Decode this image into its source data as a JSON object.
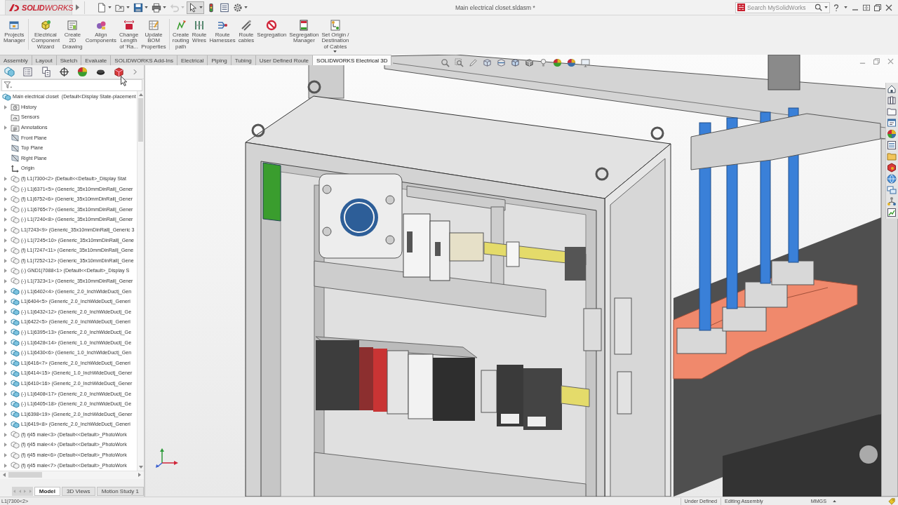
{
  "title_bar": {
    "logo": "**SOLID**WORKS",
    "title": "Main electrical closet.sldasm *",
    "search": {
      "placeholder": "Search MySolidWorks"
    }
  },
  "quick_access": [
    {
      "kind": "new",
      "dropdown": true,
      "disabled": false,
      "pressed": false
    },
    {
      "kind": "open",
      "dropdown": true,
      "disabled": false,
      "pressed": false
    },
    {
      "kind": "save",
      "dropdown": true,
      "disabled": false,
      "pressed": false
    },
    {
      "kind": "print",
      "dropdown": true,
      "disabled": false,
      "pressed": false
    },
    {
      "kind": "undo",
      "dropdown": true,
      "disabled": true,
      "pressed": false
    },
    {
      "kind": "select",
      "dropdown": true,
      "disabled": false,
      "pressed": true
    },
    {
      "kind": "rebuild",
      "dropdown": false,
      "disabled": false,
      "pressed": false
    },
    {
      "kind": "properties",
      "dropdown": false,
      "disabled": false,
      "pressed": false
    },
    {
      "kind": "options",
      "dropdown": true,
      "disabled": false,
      "pressed": false
    }
  ],
  "ribbon": [
    {
      "buttons": [
        {
          "label": "Projects\nManager",
          "dropdown": false
        }
      ]
    },
    {
      "buttons": [
        {
          "label": "Electrical\nComponent\nWizard",
          "dropdown": false
        },
        {
          "label": "Create\n2D\nDrawing",
          "dropdown": false
        },
        {
          "label": "Align\nComponents",
          "dropdown": false
        },
        {
          "label": "Change\nLength\nof 'Ra...",
          "dropdown": false
        },
        {
          "label": "Update\nBOM\nProperties",
          "dropdown": false
        }
      ]
    },
    {
      "buttons": [
        {
          "label": "Create\nrouting\npath",
          "dropdown": false
        },
        {
          "label": "Route\nWires",
          "dropdown": false
        },
        {
          "label": "Route\nHarnesses",
          "dropdown": false
        },
        {
          "label": "Route\ncables",
          "dropdown": false
        },
        {
          "label": "Segregation",
          "dropdown": false
        },
        {
          "label": "Segregation\nManager",
          "dropdown": false
        },
        {
          "label": "Set Origin /\nDestination\nof Cables",
          "dropdown": true
        }
      ]
    }
  ],
  "tabs": [
    {
      "label": "Assembly",
      "selected": false
    },
    {
      "label": "Layout",
      "selected": false
    },
    {
      "label": "Sketch",
      "selected": false
    },
    {
      "label": "Evaluate",
      "selected": false
    },
    {
      "label": "SOLIDWORKS Add-Ins",
      "selected": false
    },
    {
      "label": "Electrical",
      "selected": false
    },
    {
      "label": "Piping",
      "selected": false
    },
    {
      "label": "Tubing",
      "selected": false
    },
    {
      "label": "User Defined Route",
      "selected": false
    },
    {
      "label": "SOLIDWORKS Electrical 3D",
      "selected": true
    }
  ],
  "feature_manager": {
    "tree": {
      "label": "Main electrical closet  (Default<Display State-placement",
      "kind": "assembly",
      "children": [
        {
          "label": "History",
          "kind": "history",
          "expandable": true
        },
        {
          "label": "Sensors",
          "kind": "sensors",
          "expandable": false
        },
        {
          "label": "Annotations",
          "kind": "annotations",
          "expandable": true
        },
        {
          "label": "Front Plane",
          "kind": "plane",
          "expandable": false
        },
        {
          "label": "Top Plane",
          "kind": "plane",
          "expandable": false
        },
        {
          "label": "Right Plane",
          "kind": "plane",
          "expandable": false
        },
        {
          "label": "Origin",
          "kind": "origin",
          "expandable": false
        },
        {
          "label": "(f) L1|7300<2> (Default<<Default>_Display Stat",
          "kind": "component",
          "expandable": true
        },
        {
          "label": "(-) L1|6371<5> (Generic_35x10mmDinRail|_Gener",
          "kind": "component",
          "expandable": true
        },
        {
          "label": "(f) L1|6752<6> (Generic_35x10mmDinRail|_Gener",
          "kind": "component",
          "expandable": true
        },
        {
          "label": "(-) L1|6765<7> (Generic_35x10mmDinRail|_Gener",
          "kind": "component",
          "expandable": true
        },
        {
          "label": "(-) L1|7240<8> (Generic_35x10mmDinRail|_Gener",
          "kind": "component",
          "expandable": true
        },
        {
          "label": "L1|7243<9> (Generic_35x10mmDinRail|_Generic 3",
          "kind": "component",
          "expandable": true
        },
        {
          "label": "(-) L1|7245<10> (Generic_35x10mmDinRail|_Gene",
          "kind": "component",
          "expandable": true
        },
        {
          "label": "(f) L1|7247<11> (Generic_35x10mmDinRail|_Gene",
          "kind": "component",
          "expandable": true
        },
        {
          "label": "(f) L1|7252<12> (Generic_35x10mmDinRail|_Gene",
          "kind": "component",
          "expandable": true
        },
        {
          "label": "(-) GND1|7088<1> (Default<<Default>_Display S",
          "kind": "component",
          "expandable": true
        },
        {
          "label": "(-) L1|7323<1> (Generic_35x10mmDinRail|_Gener",
          "kind": "component",
          "expandable": true
        },
        {
          "label": "(-) L1|6402<4> (Generic_2.0_InchWideDuct|_Gen",
          "kind": "assembly",
          "expandable": true
        },
        {
          "label": "L1|6404<5> (Generic_2.0_InchWideDuct|_Generi",
          "kind": "assembly",
          "expandable": true
        },
        {
          "label": "(-) L1|6432<12> (Generic_2.0_InchWideDuct|_Ge",
          "kind": "assembly",
          "expandable": true
        },
        {
          "label": "L1|6422<5> (Generic_2.0_InchWideDuct|_Generi",
          "kind": "assembly",
          "expandable": true
        },
        {
          "label": "(-) L1|6395<13> (Generic_2.0_InchWideDuct|_Ge",
          "kind": "assembly",
          "expandable": true
        },
        {
          "label": "(-) L1|6428<14> (Generic_1.0_InchWideDuct|_Ge",
          "kind": "assembly",
          "expandable": true
        },
        {
          "label": "(-) L1|6430<6> (Generic_1.0_InchWideDuct|_Gen",
          "kind": "assembly",
          "expandable": true
        },
        {
          "label": "L1|6416<7> (Generic_2.0_InchWideDuct|_Generi",
          "kind": "assembly",
          "expandable": true
        },
        {
          "label": "L1|6414<15> (Generic_1.0_InchWideDuct|_Gener",
          "kind": "assembly",
          "expandable": true
        },
        {
          "label": "L1|6410<16> (Generic_2.0_InchWideDuct|_Gener",
          "kind": "assembly",
          "expandable": true
        },
        {
          "label": "(-) L1|6408<17> (Generic_2.0_InchWideDuct|_Ge",
          "kind": "assembly",
          "expandable": true
        },
        {
          "label": "(-) L1|6405<18> (Generic_2.0_InchWideDuct|_Ge",
          "kind": "assembly",
          "expandable": true
        },
        {
          "label": "L1|6398<19> (Generic_2.0_InchWideDuct|_Gener",
          "kind": "assembly",
          "expandable": true
        },
        {
          "label": "L1|6419<8> (Generic_2.0_InchWideDuct|_Generi",
          "kind": "assembly",
          "expandable": true
        },
        {
          "label": "(f) rj45 male<3> (Default<<Default>_PhotoWork",
          "kind": "component",
          "expandable": true
        },
        {
          "label": "(f) rj45 male<4> (Default<<Default>_PhotoWork",
          "kind": "component",
          "expandable": true
        },
        {
          "label": "(f) rj45 male<6> (Default<<Default>_PhotoWork",
          "kind": "component",
          "expandable": true
        },
        {
          "label": "(f) rj45 male<7> (Default<<Default>_PhotoWork",
          "kind": "component",
          "expandable": true
        }
      ]
    }
  },
  "model_tabs": [
    {
      "label": "Model",
      "selected": true
    },
    {
      "label": "3D Views",
      "selected": false
    },
    {
      "label": "Motion Study 1",
      "selected": false
    }
  ],
  "status_bar": {
    "selection": "L1|7300<2>",
    "items": [
      "Under Defined",
      "Editing Assembly",
      "MMGS"
    ]
  }
}
